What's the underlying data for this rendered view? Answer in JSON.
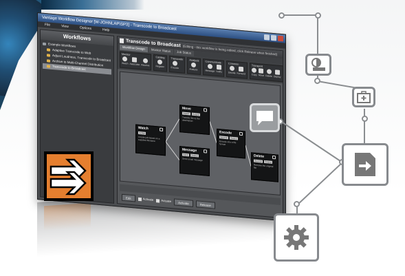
{
  "app": {
    "window_title": "Vantage Workflow Designer [W-JOHNLAP\\SP3] - Transcode to Broadcast",
    "menu": [
      "File",
      "View",
      "Options",
      "Help"
    ],
    "left_panel_title": "Workflows",
    "workflows": [
      {
        "label": "Example Workflows",
        "kind": "root"
      },
      {
        "label": "Adaptive Transcode to Web",
        "kind": "child"
      },
      {
        "label": "Adjust Loudness, Transcode to Broadcast",
        "kind": "child"
      },
      {
        "label": "Archive to Multi-Channel Distribution",
        "kind": "child"
      },
      {
        "label": "Transcode to Broadcast",
        "kind": "child",
        "selected": true
      }
    ],
    "workflow_title": "Transcode to Broadcast",
    "workflow_status": "(Editing - this workflow is being edited, click Release when finished)",
    "tabs": [
      "Workflow Design",
      "Monitor Status",
      "Job Status"
    ],
    "ribbon": [
      {
        "group": "Monitor",
        "items": [
          "Watch",
          "Associate",
          "Receive"
        ]
      },
      {
        "group": "Catalog",
        "items": [
          "Register"
        ]
      },
      {
        "group": "Transcode",
        "items": [
          "Encode"
        ]
      },
      {
        "group": "Analysis",
        "items": [
          "Analyze"
        ]
      },
      {
        "group": "Communicate",
        "items": [
          "Message",
          "Notify"
        ]
      },
      {
        "group": "Common",
        "items": [
          "Decide",
          "Forward"
        ]
      },
      {
        "group": "Transport",
        "items": [
          "Copy",
          "Move",
          "Delete",
          "Deploy"
        ]
      }
    ],
    "nodes": [
      {
        "id": "watch",
        "title": "Watch",
        "ports": [
          "Action"
        ],
        "desc": "Create job based on a supplied filename"
      },
      {
        "id": "move",
        "title": "Move",
        "ports": [
          "Import",
          "Output"
        ],
        "desc": "Transfer file to the destination"
      },
      {
        "id": "message",
        "title": "Message",
        "ports": [
          "Input",
          "Output"
        ],
        "desc": "Send email message"
      },
      {
        "id": "encode",
        "title": "Encode",
        "ports": [
          "Source",
          "Output"
        ],
        "desc": "Encode into a file format"
      },
      {
        "id": "delete",
        "title": "Delete",
        "ports": [
          "Source",
          "Output"
        ],
        "desc": "Remove the original file"
      }
    ],
    "bottom": {
      "buttons": [
        "Edit",
        "Activate",
        "Release"
      ],
      "checks": [
        "Activate",
        "Actuate"
      ]
    }
  },
  "decor": {
    "accent": "#e57f2f",
    "graph_line": "#8a8d90",
    "icons": [
      "contrast-ruler-icon",
      "first-aid-kit-icon",
      "speech-bubble-icon",
      "document-arrow-icon",
      "gear-icon"
    ]
  }
}
